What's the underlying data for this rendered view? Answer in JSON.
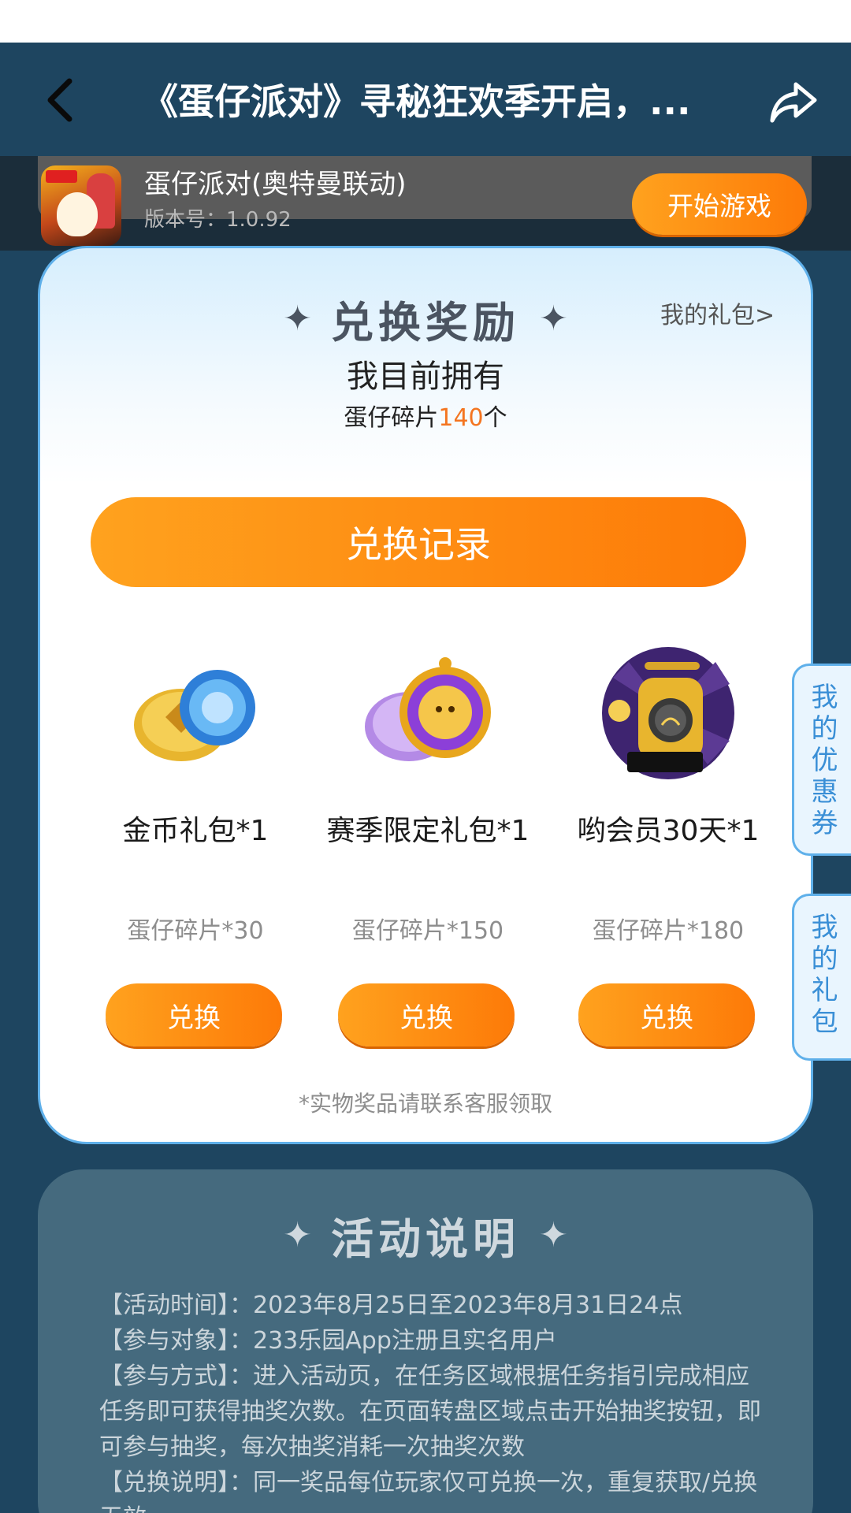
{
  "header": {
    "title": "《蛋仔派对》寻秘狂欢季开启，...",
    "back_icon": "chevron-left-icon",
    "share_icon": "share-arrow-icon"
  },
  "game_bar": {
    "name": "蛋仔派对(奥特曼联动)",
    "version": "版本号：1.0.92",
    "start_label": "开始游戏"
  },
  "reward": {
    "title": "兑换奖励",
    "my_gifts_link": "我的礼包>",
    "owned_label": "我目前拥有",
    "owned_prefix": "蛋仔碎片",
    "owned_count": "140",
    "owned_suffix": "个",
    "history_label": "兑换记录",
    "items": [
      {
        "name": "金币礼包*1",
        "cost": "蛋仔碎片*30",
        "button": "兑换"
      },
      {
        "name": "赛季限定礼包*1",
        "cost": "蛋仔碎片*150",
        "button": "兑换"
      },
      {
        "name": "哟会员30天*1",
        "cost": "蛋仔碎片*180",
        "button": "兑换"
      }
    ],
    "disclaimer": "*实物奖品请联系客服领取"
  },
  "side_tabs": {
    "coupons": "我的优惠券",
    "gifts": "我的礼包"
  },
  "rules": {
    "title": "活动说明",
    "lines": [
      "【活动时间】：2023年8月25日至2023年8月31日24点",
      "【参与对象】：233乐园App注册且实名用户",
      "【参与方式】：进入活动页，在任务区域根据任务指引完成相应任务即可获得抽奖次数。在页面转盘区域点击开始抽奖按钮，即可参与抽奖，每次抽奖消耗一次抽奖次数",
      "【兑换说明】：同一奖品每位玩家仅可兑换一次，重复获取/兑换无效"
    ]
  },
  "colors": {
    "background": "#1e4560",
    "accent_orange": "#fd7a08",
    "count_orange": "#f47520",
    "side_tab_blue": "#3a8fd6"
  }
}
